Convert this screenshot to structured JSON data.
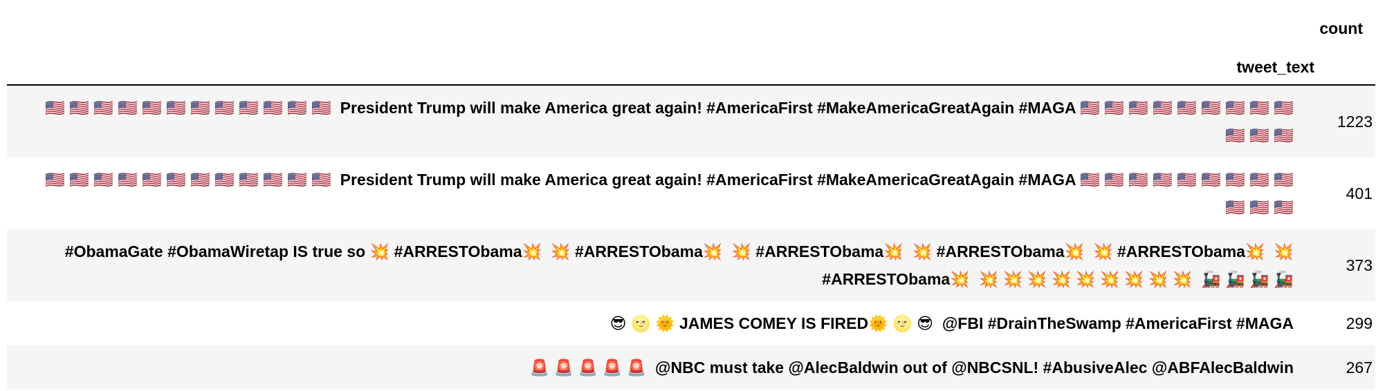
{
  "table": {
    "header": {
      "count_label": "count",
      "tweet_text_label": "tweet_text"
    },
    "rows": [
      {
        "tweet_text": "🇺🇸 🇺🇸 🇺🇸 🇺🇸 🇺🇸 🇺🇸 🇺🇸 🇺🇸 🇺🇸 🇺🇸 🇺🇸 🇺🇸  President Trump will make America great again! #AmericaFirst #MakeAmericaGreatAgain #MAGA 🇺🇸 🇺🇸 🇺🇸 🇺🇸 🇺🇸 🇺🇸 🇺🇸 🇺🇸 🇺🇸 🇺🇸 🇺🇸 🇺🇸",
        "count": "1223"
      },
      {
        "tweet_text": "🇺🇸 🇺🇸 🇺🇸 🇺🇸 🇺🇸 🇺🇸 🇺🇸 🇺🇸 🇺🇸 🇺🇸 🇺🇸 🇺🇸  President Trump will make America great again! #AmericaFirst #MakeAmericaGreatAgain #MAGA 🇺🇸 🇺🇸 🇺🇸 🇺🇸 🇺🇸 🇺🇸 🇺🇸 🇺🇸 🇺🇸 🇺🇸 🇺🇸 🇺🇸",
        "count": "401"
      },
      {
        "tweet_text": "#ObamaGate #ObamaWiretap IS true so 💥 #ARRESTObama💥  💥 #ARRESTObama💥  💥 #ARRESTObama💥  💥 #ARRESTObama💥  💥 #ARRESTObama💥  💥 #ARRESTObama💥  💥 💥 💥 💥 💥 💥 💥 💥 💥  🚂 🚂 🚂 🚂",
        "count": "373"
      },
      {
        "tweet_text": "😎 🌝 🌞 JAMES COMEY IS FIRED🌞 🌝 😎  @FBI #DrainTheSwamp #AmericaFirst #MAGA",
        "count": "299"
      },
      {
        "tweet_text": "🚨 🚨 🚨 🚨 🚨  @NBC must take @AlecBaldwin out of @NBCSNL! #AbusiveAlec @ABFAlecBaldwin",
        "count": "267"
      }
    ]
  }
}
